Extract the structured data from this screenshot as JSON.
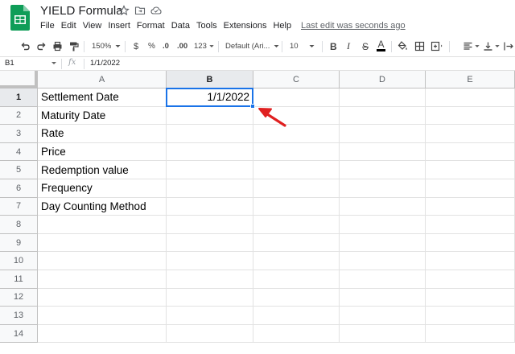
{
  "title_bar": {
    "doc_title": "YIELD Formula",
    "last_edit": "Last edit was seconds ago",
    "menu": [
      "File",
      "Edit",
      "View",
      "Insert",
      "Format",
      "Data",
      "Tools",
      "Extensions",
      "Help"
    ]
  },
  "toolbar": {
    "zoom": "150%",
    "currency": "$",
    "percent": "%",
    "decrease_decimals": ".0",
    "increase_decimals": ".00",
    "more_formats": "123",
    "font": "Default (Ari...",
    "font_size": "10",
    "bold": "B",
    "italic": "I",
    "strikethrough": "S",
    "text_color": "A"
  },
  "formula_bar": {
    "cell_ref": "B1",
    "fx": "fx",
    "value": "1/1/2022"
  },
  "columns": [
    "A",
    "B",
    "C",
    "D",
    "E"
  ],
  "rows": [
    "1",
    "2",
    "3",
    "4",
    "5",
    "6",
    "7",
    "8",
    "9",
    "10",
    "11",
    "12",
    "13",
    "14"
  ],
  "cells": {
    "A1": "Settlement Date",
    "A2": "Maturity Date",
    "A3": "Rate",
    "A4": "Price",
    "A5": "Redemption value",
    "A6": "Frequency",
    "A7": "Day Counting Method",
    "B1": "1/1/2022"
  },
  "selected_cell": "B1",
  "colors": {
    "accent": "#1a73e8",
    "sheets_green": "#0f9d58",
    "arrow": "#e02020"
  }
}
